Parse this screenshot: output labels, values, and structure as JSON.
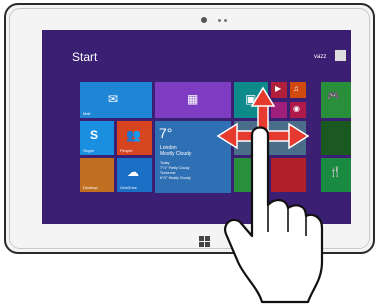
{
  "screen": {
    "start_title": "Start",
    "user_name": "vazz",
    "tiles": [
      {
        "id": "mail",
        "label": "Mail",
        "color": "#1f86d6",
        "glyph": "✉"
      },
      {
        "id": "calendar",
        "label": "",
        "color": "#7d3cc2",
        "glyph": "▦"
      },
      {
        "id": "photos",
        "label": "",
        "color": "#0e8a8a",
        "glyph": "▣"
      },
      {
        "id": "skype",
        "label": "Skype",
        "color": "#1a8fe0",
        "glyph": "S"
      },
      {
        "id": "people",
        "label": "People",
        "color": "#d6451f",
        "glyph": "👥"
      },
      {
        "id": "onedrive",
        "label": "OneDrive",
        "color": "#1a6fc4",
        "glyph": "☁"
      },
      {
        "id": "desktop",
        "label": "Desktop",
        "color": "#c07020",
        "glyph": ""
      },
      {
        "id": "store",
        "label": "",
        "color": "#2a8f3a",
        "glyph": ""
      },
      {
        "id": "video",
        "label": "",
        "color": "#b0203a",
        "glyph": "▶"
      },
      {
        "id": "music",
        "label": "",
        "color": "#d04a10",
        "glyph": "♫"
      },
      {
        "id": "camera",
        "label": "",
        "color": "#b01a4a",
        "glyph": "◉"
      },
      {
        "id": "maps",
        "label": "",
        "color": "#a01f7a",
        "glyph": ""
      },
      {
        "id": "games",
        "label": "",
        "color": "#2a8f3a",
        "glyph": "🎮"
      },
      {
        "id": "health",
        "label": "",
        "color": "#1a5a20",
        "glyph": ""
      },
      {
        "id": "food",
        "label": "",
        "color": "#1a8a40",
        "glyph": "🍴"
      },
      {
        "id": "news",
        "label": "",
        "color": "#b0202a",
        "glyph": ""
      }
    ],
    "weather": {
      "temp": "7°",
      "city": "London",
      "condition": "Mostly Cloudy",
      "today": "Today",
      "today_forecast": "7°/1° Partly Cloudy",
      "tomorrow": "Tomorrow",
      "tomorrow_forecast": "6°/2° Mostly Cloudy",
      "color": "#2f6fb3"
    },
    "background_color": "#3a1f73",
    "accent_color": "#e53a2d"
  }
}
